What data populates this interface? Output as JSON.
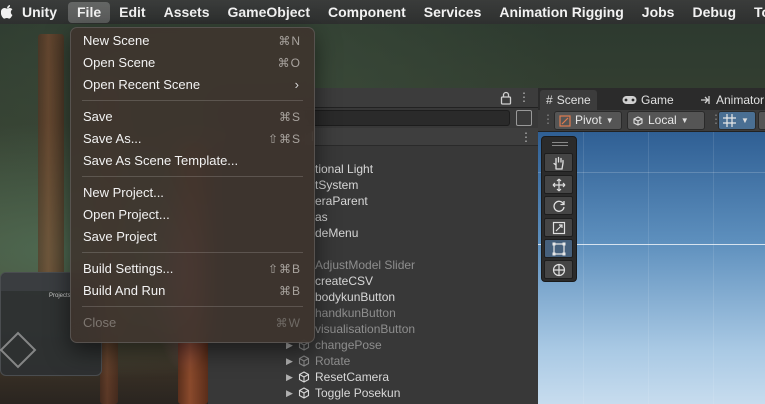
{
  "menubar": {
    "app_name": "Unity",
    "items": [
      "File",
      "Edit",
      "Assets",
      "GameObject",
      "Component",
      "Services",
      "Animation Rigging",
      "Jobs",
      "Debug",
      "Tools"
    ],
    "active": "File"
  },
  "file_menu": {
    "groups": [
      [
        {
          "label": "New Scene",
          "shortcut": "⌘N",
          "enabled": true
        },
        {
          "label": "Open Scene",
          "shortcut": "⌘O",
          "enabled": true
        },
        {
          "label": "Open Recent Scene",
          "shortcut": "",
          "submenu": true,
          "enabled": true
        }
      ],
      [
        {
          "label": "Save",
          "shortcut": "⌘S",
          "enabled": true
        },
        {
          "label": "Save As...",
          "shortcut": "⇧⌘S",
          "enabled": true
        },
        {
          "label": "Save As Scene Template...",
          "shortcut": "",
          "enabled": true
        }
      ],
      [
        {
          "label": "New Project...",
          "shortcut": "",
          "enabled": true
        },
        {
          "label": "Open Project...",
          "shortcut": "",
          "enabled": true
        },
        {
          "label": "Save Project",
          "shortcut": "",
          "enabled": true
        }
      ],
      [
        {
          "label": "Build Settings...",
          "shortcut": "⇧⌘B",
          "enabled": true
        },
        {
          "label": "Build And Run",
          "shortcut": "⌘B",
          "enabled": true
        }
      ],
      [
        {
          "label": "Close",
          "shortcut": "⌘W",
          "enabled": false
        }
      ]
    ]
  },
  "background_window": {
    "title": "Projects"
  },
  "hierarchy": {
    "scene_label_fragment": "l",
    "items": [
      {
        "label": "tional Light",
        "dim": false,
        "expander": false,
        "icon": false
      },
      {
        "label": "tSystem",
        "dim": false,
        "expander": false,
        "icon": false
      },
      {
        "label": "eraParent",
        "dim": false,
        "expander": false,
        "icon": false
      },
      {
        "label": "as",
        "dim": false,
        "expander": false,
        "icon": false
      },
      {
        "label": "deMenu",
        "dim": false,
        "expander": false,
        "icon": false
      },
      {
        "label": "",
        "dim": false,
        "expander": false,
        "icon": false
      },
      {
        "label": "AdjustModel Slider",
        "dim": true,
        "expander": false,
        "icon": false
      },
      {
        "label": "createCSV",
        "dim": false,
        "expander": false,
        "icon": false
      },
      {
        "label": "bodykunButton",
        "dim": false,
        "expander": false,
        "icon": false
      },
      {
        "label": "handkunButton",
        "dim": true,
        "expander": false,
        "icon": false
      },
      {
        "label": "visualisationButton",
        "dim": true,
        "expander": false,
        "icon": false
      },
      {
        "label": "changePose",
        "dim": true,
        "expander": true,
        "icon": true
      },
      {
        "label": "Rotate",
        "dim": true,
        "expander": true,
        "icon": true
      },
      {
        "label": "ResetCamera",
        "dim": false,
        "expander": true,
        "icon": true
      },
      {
        "label": "Toggle Posekun",
        "dim": false,
        "expander": true,
        "icon": true
      }
    ]
  },
  "scene_panel": {
    "tabs": [
      {
        "label": "Scene",
        "icon": "hash-icon",
        "active": true
      },
      {
        "label": "Game",
        "icon": "gamepad-icon",
        "active": false
      },
      {
        "label": "Animator",
        "icon": "animator-icon",
        "active": false
      }
    ],
    "toolbar": {
      "pivot_label": "Pivot",
      "space_label": "Local"
    },
    "tools": [
      "hand-tool-icon",
      "move-tool-icon",
      "rotate-tool-icon",
      "scale-tool-icon",
      "rect-tool-icon",
      "transform-tool-icon"
    ],
    "selected_tool": "rect-tool-icon"
  }
}
